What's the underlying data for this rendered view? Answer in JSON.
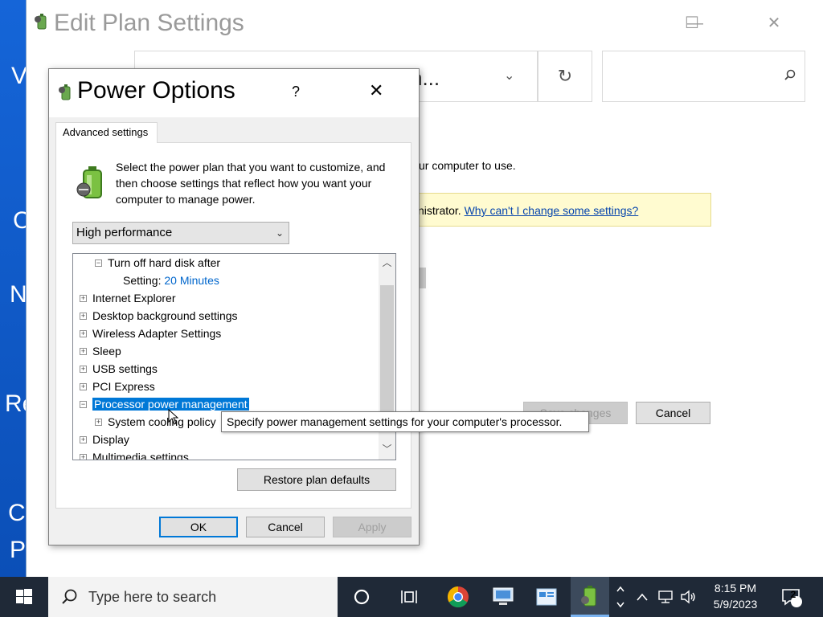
{
  "desktop": {
    "left_glyphs": [
      "V",
      "C",
      "N",
      "Re",
      "C",
      "P"
    ]
  },
  "back_window": {
    "title": "Edit Plan Settings",
    "address_text": "...Edit Plan Settin...",
    "address_visible": "n...",
    "body_text": "ur computer to use.",
    "info_prefix": "nistrator.",
    "info_link": "Why can't I change some settings?",
    "save_label": "Save changes",
    "cancel_label": "Cancel"
  },
  "dialog": {
    "title": "Power Options",
    "help": "?",
    "tab": "Advanced settings",
    "intro": "Select the power plan that you want to customize, and then choose settings that reflect how you want your computer to manage power.",
    "plan": "High performance",
    "tree": [
      {
        "label": "Turn off hard disk after",
        "expander": "−"
      },
      {
        "label": "Setting:",
        "value": "20 Minutes"
      },
      {
        "label": "Internet Explorer",
        "expander": "+"
      },
      {
        "label": "Desktop background settings",
        "expander": "+"
      },
      {
        "label": "Wireless Adapter Settings",
        "expander": "+"
      },
      {
        "label": "Sleep",
        "expander": "+"
      },
      {
        "label": "USB settings",
        "expander": "+"
      },
      {
        "label": "PCI Express",
        "expander": "+"
      },
      {
        "label": "Processor power management",
        "expander": "−",
        "selected": true
      },
      {
        "label": "System cooling policy",
        "expander": "+"
      },
      {
        "label": "Display",
        "expander": "+"
      },
      {
        "label": "Multimedia settings",
        "expander": "+"
      }
    ],
    "restore_label": "Restore plan defaults",
    "ok_label": "OK",
    "cancel_label": "Cancel",
    "apply_label": "Apply"
  },
  "tooltip": "Specify power management settings for your computer's processor.",
  "taskbar": {
    "search_placeholder": "Type here to search",
    "time": "8:15 PM",
    "date": "5/9/2023",
    "notification_count": "2"
  },
  "colors": {
    "accent": "#0078d7",
    "link": "#0645ad",
    "info_bg": "#fffbd0",
    "taskbar": "#1f2937"
  }
}
